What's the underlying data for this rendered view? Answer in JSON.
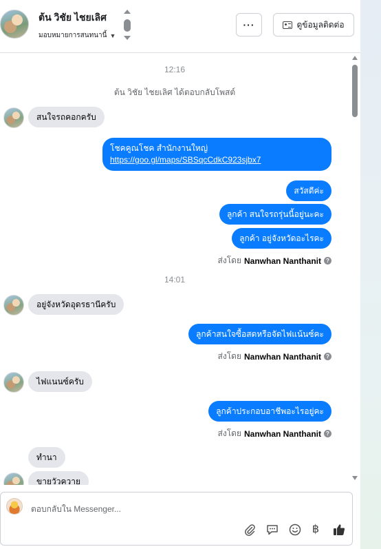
{
  "header": {
    "contact_name": "ต้น วิชัย ไชยเลิศ",
    "assign_label": "มอบหมายการสนทนานี้",
    "more_label": "···",
    "view_contact_label": "ดูข้อมูลติดต่อ"
  },
  "conversation": {
    "timestamps": [
      "12:16",
      "14:01"
    ],
    "system_note": "ต้น วิชัย ไชยเลิศ ได้ตอบกลับโพสต์",
    "messages": {
      "in1": "สนใจรถคอกครับ",
      "out_link_text": "โชคคูณโชค สำนักงานใหญ่",
      "out_link_url": "https://goo.gl/maps/SBSqcCdkC923sjbx7",
      "out1": "สวัสดีค่ะ",
      "out2": "ลูกค้า สนใจรถรุ่นนี้อยู่นะคะ",
      "out3": "ลูกค้า อยู่จังหวัดอะไรคะ",
      "in2": "อยู่จังหวัดอุดรธานีครับ",
      "out4": "ลูกค้าสนใจซื้อสดหรือจัดไฟแน้นซ์คะ",
      "in3": "ไฟแนนซ์ครับ",
      "out5": "ลูกค้าประกอบอาชีพอะไรอยู่คะ",
      "in4": "ทำนา",
      "in5": "ขายวัวควาย"
    },
    "sent_by_prefix": "ส่งโดย",
    "sent_by_name": "Nanwhan Nanthanit"
  },
  "composer": {
    "placeholder": "ตอบกลับใน Messenger...",
    "tools": [
      "paperclip-icon",
      "chat-icon",
      "emoji-icon",
      "baht-icon",
      "thumbs-up-icon"
    ],
    "baht_glyph": "฿"
  },
  "colors": {
    "outgoing_bubble": "#0a7cff",
    "incoming_bubble": "#e4e6eb",
    "muted_text": "#65676b"
  }
}
